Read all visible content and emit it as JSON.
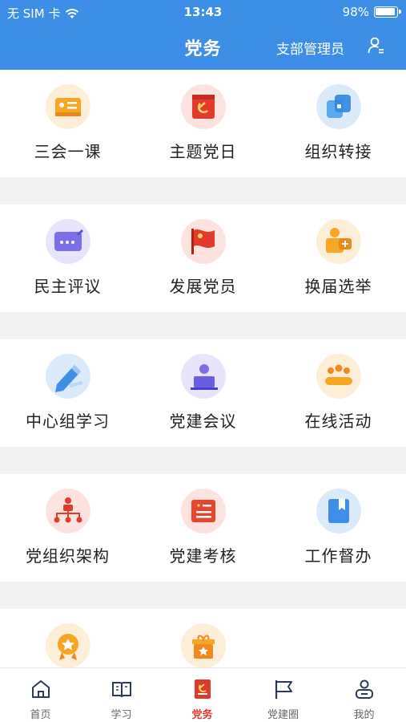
{
  "status_bar": {
    "carrier": "无 SIM 卡",
    "time": "13:43",
    "battery": "98%"
  },
  "nav": {
    "title": "党务",
    "role": "支部管理员",
    "user_icon": "user-switch-icon"
  },
  "sections": [
    {
      "items": [
        {
          "label": "三会一课",
          "icon": "lecture-board-icon"
        },
        {
          "label": "主题党日",
          "icon": "party-flag-icon"
        },
        {
          "label": "组织转接",
          "icon": "transfer-icon"
        }
      ]
    },
    {
      "items": [
        {
          "label": "民主评议",
          "icon": "comment-board-icon"
        },
        {
          "label": "发展党员",
          "icon": "waving-flag-icon"
        },
        {
          "label": "换届选举",
          "icon": "election-box-icon"
        }
      ]
    },
    {
      "items": [
        {
          "label": "中心组学习",
          "icon": "pencil-study-icon"
        },
        {
          "label": "党建会议",
          "icon": "meeting-podium-icon"
        },
        {
          "label": "在线活动",
          "icon": "group-activity-icon"
        }
      ]
    },
    {
      "items": [
        {
          "label": "党组织架构",
          "icon": "org-chart-icon"
        },
        {
          "label": "党建考核",
          "icon": "assessment-scroll-icon"
        },
        {
          "label": "工作督办",
          "icon": "bookmark-book-icon"
        }
      ]
    },
    {
      "items": [
        {
          "label": "",
          "icon": "medal-icon"
        },
        {
          "label": "",
          "icon": "gift-star-icon"
        }
      ]
    }
  ],
  "tabbar": [
    {
      "label": "首页",
      "icon": "home-icon",
      "active": false
    },
    {
      "label": "学习",
      "icon": "book-icon",
      "active": false
    },
    {
      "label": "党务",
      "icon": "party-affairs-icon",
      "active": true
    },
    {
      "label": "党建圈",
      "icon": "flag-circle-icon",
      "active": false
    },
    {
      "label": "我的",
      "icon": "profile-icon",
      "active": false
    }
  ],
  "colors": {
    "header": "#3d8ee6",
    "active_tab": "#e03a2e",
    "background": "#f2f2f3"
  }
}
